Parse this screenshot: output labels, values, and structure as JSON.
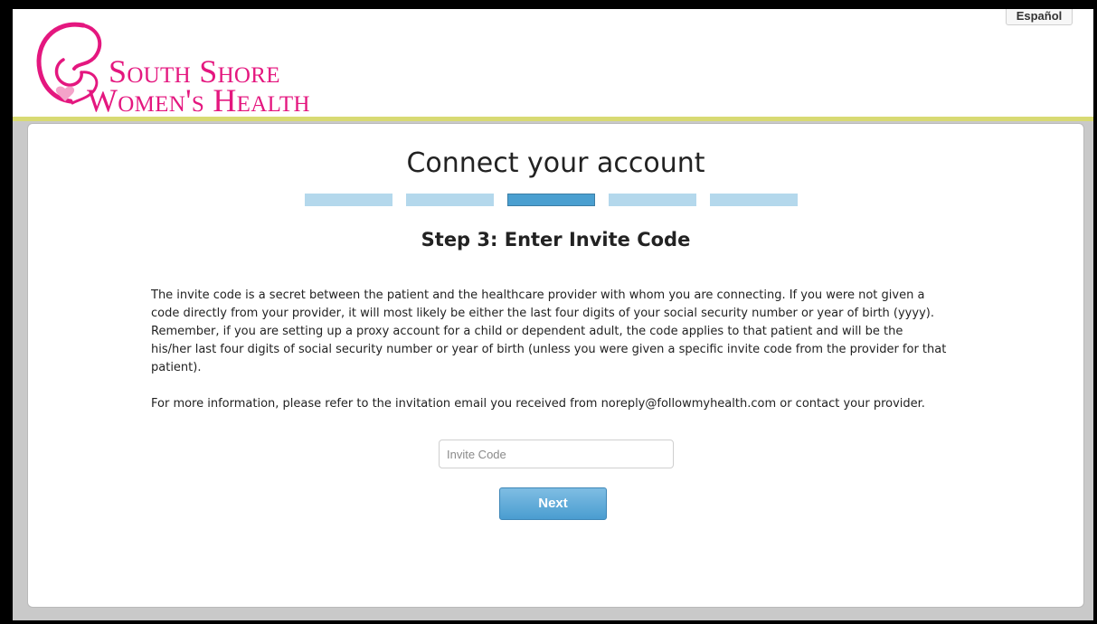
{
  "header": {
    "language_button": "Español",
    "logo": {
      "line1": "South Shore",
      "line2": "Women's Health",
      "color": "#e4177f"
    },
    "accent_color": "#d8da73"
  },
  "main": {
    "title": "Connect your account",
    "progress": {
      "total_steps": 5,
      "current_step": 3
    },
    "step_title": "Step 3: Enter Invite Code",
    "description": [
      "The invite code is a secret between the patient and the healthcare provider with whom you are connecting.  If you were not given a code directly from your provider, it will most likely be either the last four digits of your social security number or year of birth (yyyy).  Remember, if you are setting up a proxy account for a child or dependent adult, the code applies to that patient and will be the his/her last four digits of social security number or year of birth (unless you were given a specific invite code from the provider for that patient).",
      "For more information, please refer to the invitation email you received from noreply@followmyhealth.com or contact your provider."
    ],
    "invite_input": {
      "placeholder": "Invite Code",
      "value": ""
    },
    "next_button": "Next"
  }
}
